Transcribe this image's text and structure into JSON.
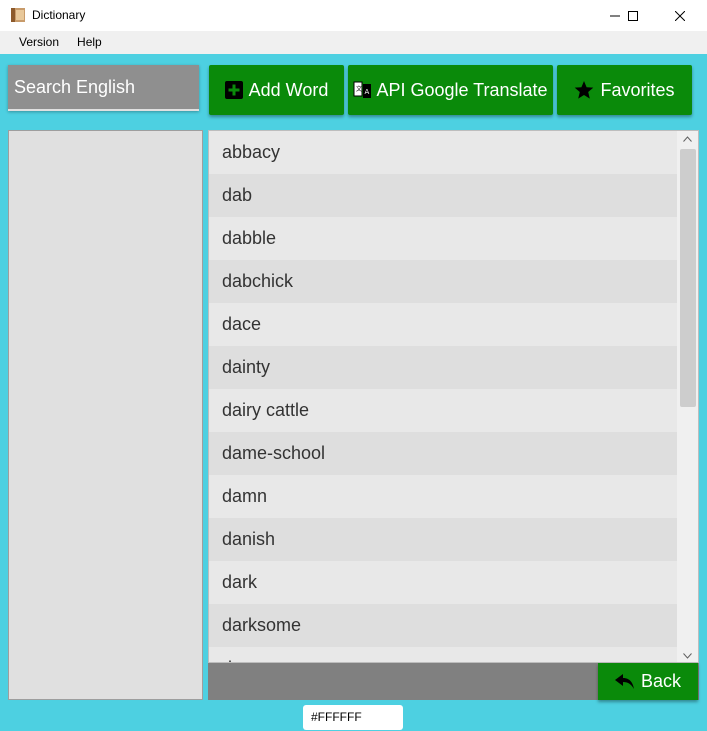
{
  "window": {
    "title": "Dictionary"
  },
  "menu": {
    "items": [
      "Version",
      "Help"
    ]
  },
  "search": {
    "placeholder": "Search English"
  },
  "toolbar": {
    "add_word_label": "Add Word",
    "api_translate_label": "API Google Translate",
    "favorites_label": "Favorites"
  },
  "word_list": {
    "items": [
      "abbacy",
      "dab",
      "dabble",
      "dabchick",
      "dace",
      "dainty",
      "dairy cattle",
      "dame-school",
      "damn",
      "danish",
      "dark",
      "darksome",
      "d"
    ]
  },
  "back_button": {
    "label": "Back"
  },
  "color_field": {
    "value": "#FFFFFF"
  },
  "colors": {
    "background": "#4dd0e1",
    "button_green": "#0a8a0a",
    "row_light": "#e8e8e8",
    "row_dark": "#dedede",
    "panel_gray": "#e0e0e0",
    "bottom_bar": "#808080"
  }
}
